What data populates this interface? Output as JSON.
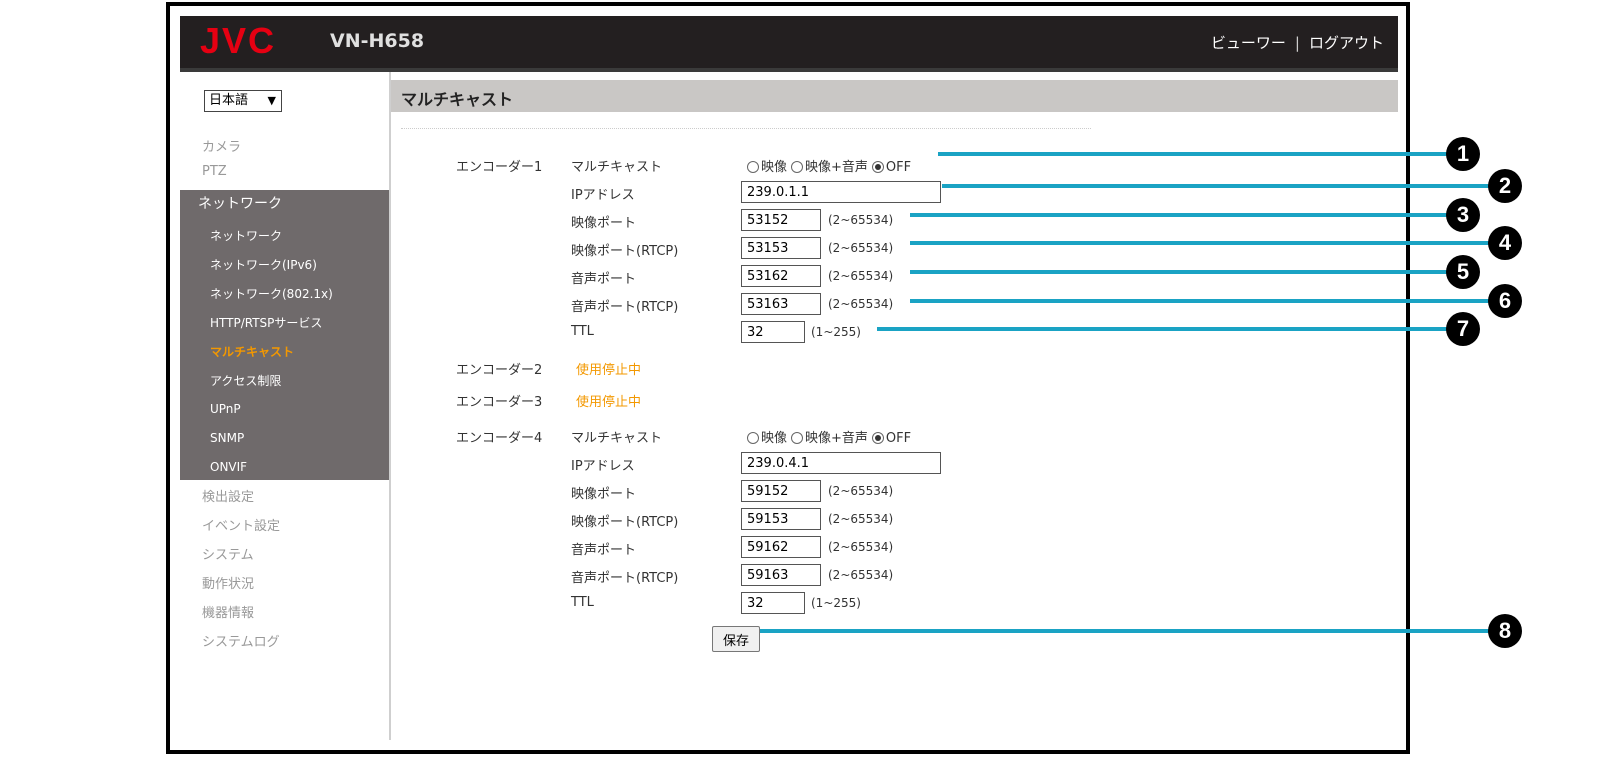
{
  "header": {
    "logo": "JVC",
    "model": "VN-H658",
    "viewer_link": "ビューワー",
    "separator": "|",
    "logout_link": "ログアウト"
  },
  "sidebar": {
    "language": "日本語",
    "items_top": [
      "カメラ",
      "PTZ"
    ],
    "group_title": "ネットワーク",
    "group_items": [
      "ネットワーク",
      "ネットワーク(IPv6)",
      "ネットワーク(802.1x)",
      "HTTP/RTSPサービス",
      "マルチキャスト",
      "アクセス制限",
      "UPnP",
      "SNMP",
      "ONVIF"
    ],
    "active_item": "マルチキャスト",
    "items_bottom": [
      "検出設定",
      "イベント設定",
      "システム",
      "動作状況",
      "機器情報",
      "システムログ"
    ]
  },
  "page": {
    "title": "マルチキャスト"
  },
  "labels": {
    "multicast": "マルチキャスト",
    "ip_address": "IPアドレス",
    "video_port": "映像ポート",
    "video_port_rtcp": "映像ポート(RTCP)",
    "audio_port": "音声ポート",
    "audio_port_rtcp": "音声ポート(RTCP)",
    "ttl": "TTL",
    "opt_video": "映像",
    "opt_video_audio": "映像+音声",
    "opt_off": "OFF",
    "port_range": "(2~65534)",
    "ttl_range": "(1~255)"
  },
  "encoders": {
    "enc1": {
      "name": "エンコーダー1",
      "multicast_selected": "OFF",
      "ip": "239.0.1.1",
      "video_port": "53152",
      "video_port_rtcp": "53153",
      "audio_port": "53162",
      "audio_port_rtcp": "53163",
      "ttl": "32"
    },
    "enc2": {
      "name": "エンコーダー2",
      "status": "使用停止中"
    },
    "enc3": {
      "name": "エンコーダー3",
      "status": "使用停止中"
    },
    "enc4": {
      "name": "エンコーダー4",
      "multicast_selected": "OFF",
      "ip": "239.0.4.1",
      "video_port": "59152",
      "video_port_rtcp": "59153",
      "audio_port": "59162",
      "audio_port_rtcp": "59163",
      "ttl": "32"
    }
  },
  "save_label": "保存",
  "callouts": [
    "1",
    "2",
    "3",
    "4",
    "5",
    "6",
    "7",
    "8"
  ],
  "colors": {
    "header_bg": "#231f20",
    "logo_red": "#e60012",
    "active_orange": "#f39800",
    "sidebar_group_bg": "#6f6a6b",
    "title_bar_bg": "#c9c7c5",
    "callout_line": "#1aa3c4"
  }
}
